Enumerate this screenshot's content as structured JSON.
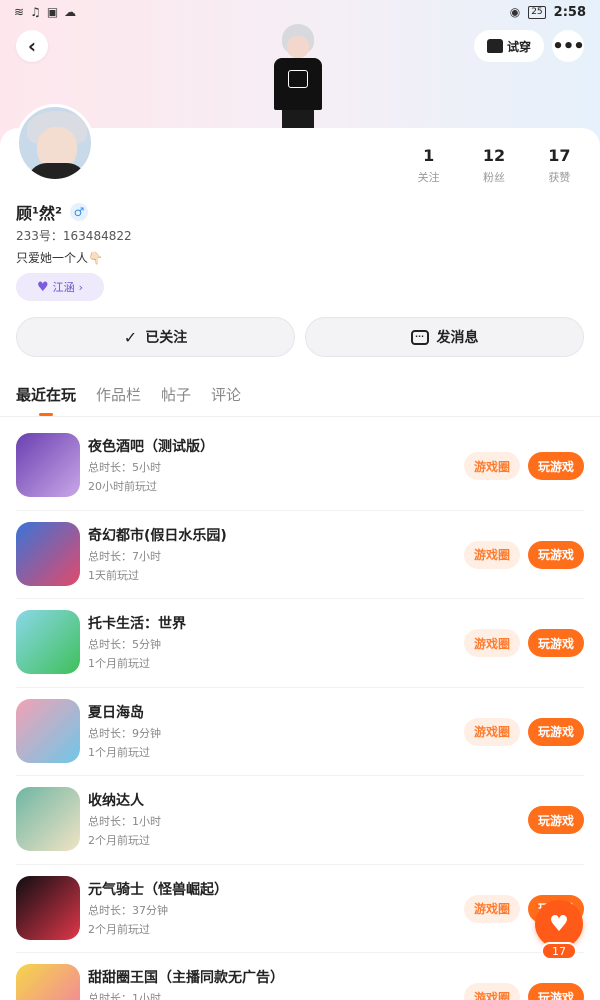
{
  "status_bar": {
    "time": "2:58",
    "battery": "25",
    "icons": [
      "wifi-icon",
      "music-icon",
      "photo-icon",
      "cloud-icon",
      "eye-icon",
      "battery-icon"
    ]
  },
  "header": {
    "back_icon": "back-arrow-icon",
    "tryon_label": "试穿",
    "tryon_icon": "tshirt-icon",
    "more_icon": "more-dots-icon"
  },
  "profile": {
    "name": "顾¹然²",
    "gender_icon": "male-icon",
    "uid": "233号：163484822",
    "bio": "只爱她一个人👇🏻",
    "tag_label": "江涵",
    "stats": [
      {
        "value": "1",
        "label": "关注"
      },
      {
        "value": "12",
        "label": "粉丝"
      },
      {
        "value": "17",
        "label": "获赞"
      }
    ]
  },
  "actions": {
    "follow_label": "已关注",
    "message_label": "发消息"
  },
  "tabs": [
    "最近在玩",
    "作品栏",
    "帖子",
    "评论"
  ],
  "games": [
    {
      "title": "夜色酒吧（测试版）",
      "duration": "总时长：5小时",
      "last_played": "20小时前玩过",
      "circle_label": "游戏圈",
      "play_label": "玩游戏",
      "icon_colors": [
        "#6a3fb0",
        "#c9a7e8"
      ]
    },
    {
      "title": "奇幻都市(假日水乐园)",
      "duration": "总时长：7小时",
      "last_played": "1天前玩过",
      "circle_label": "游戏圈",
      "play_label": "玩游戏",
      "icon_colors": [
        "#3a74d8",
        "#e24a6a"
      ]
    },
    {
      "title": "托卡生活：世界",
      "duration": "总时长：5分钟",
      "last_played": "1个月前玩过",
      "circle_label": "游戏圈",
      "play_label": "玩游戏",
      "icon_colors": [
        "#8ad7e8",
        "#3fc05a"
      ]
    },
    {
      "title": "夏日海岛",
      "duration": "总时长：9分钟",
      "last_played": "1个月前玩过",
      "circle_label": "游戏圈",
      "play_label": "玩游戏",
      "icon_colors": [
        "#f3a1b5",
        "#6ec7e8"
      ]
    },
    {
      "title": "收纳达人",
      "duration": "总时长：1小时",
      "last_played": "2个月前玩过",
      "circle_label": "",
      "play_label": "玩游戏",
      "icon_colors": [
        "#6fb6a4",
        "#f1e3c4"
      ]
    },
    {
      "title": "元气骑士（怪兽崛起）",
      "duration": "总时长：37分钟",
      "last_played": "2个月前玩过",
      "circle_label": "游戏圈",
      "play_label": "玩游戏",
      "icon_colors": [
        "#0e0e12",
        "#e0374a"
      ]
    },
    {
      "title": "甜甜圈王国（主播同款无广告）",
      "duration": "总时长：1小时",
      "last_played": "",
      "circle_label": "游戏圈",
      "play_label": "玩游戏",
      "icon_colors": [
        "#f5d64a",
        "#f27aa6"
      ]
    }
  ],
  "fab": {
    "icon": "heart-icon",
    "count": "17"
  },
  "colors": {
    "accent": "#ff6e1a",
    "accent_light": "#ffeee3",
    "tag_bg": "#eee9fb"
  }
}
